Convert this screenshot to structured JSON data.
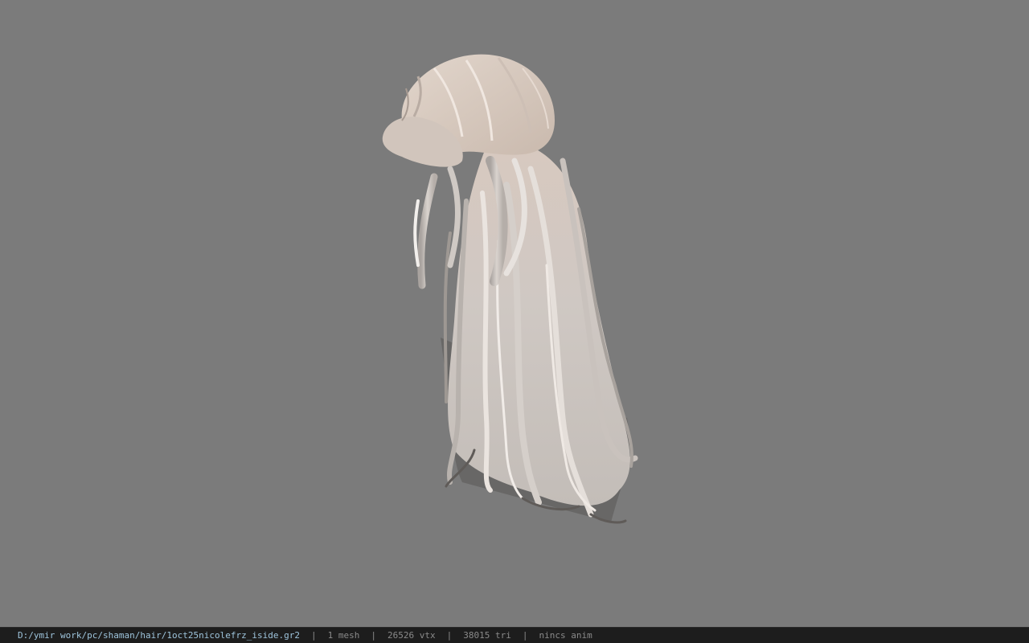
{
  "viewer": {
    "background_color": "#7b7b7b",
    "model_subject": "long hair mesh",
    "hair_color": "#d9ccc4"
  },
  "status_bar": {
    "file_path": "D:/ymir work/pc/shaman/hair/1oct25nicolefrz_iside.gr2",
    "separator": "|",
    "mesh_count": "1 mesh",
    "vertex_count": "26526 vtx",
    "triangle_count": "38015 tri",
    "anim_status": "nincs anim",
    "path_color": "#9ec4dc",
    "text_color": "#8a8a8a"
  }
}
